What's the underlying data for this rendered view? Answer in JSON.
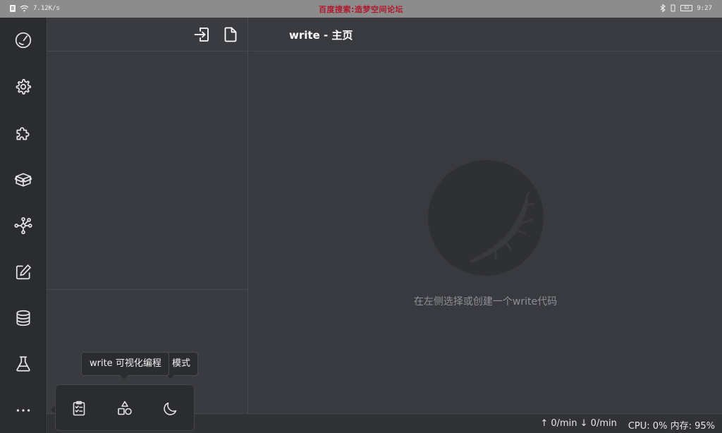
{
  "status_bar": {
    "net_speed": "7.12K/s",
    "banner": "百度搜索:造梦空间论坛",
    "battery": "82",
    "time": "9:27"
  },
  "rail": {
    "items": [
      {
        "id": "dashboard",
        "icon": "gauge-icon"
      },
      {
        "id": "settings",
        "icon": "gear-icon"
      },
      {
        "id": "plugins",
        "icon": "puzzle-icon"
      },
      {
        "id": "packages",
        "icon": "box-icon"
      },
      {
        "id": "network",
        "icon": "network-icon"
      },
      {
        "id": "editor",
        "icon": "edit-icon"
      },
      {
        "id": "database",
        "icon": "database-icon"
      },
      {
        "id": "lab",
        "icon": "flask-icon"
      }
    ],
    "more_label": "···"
  },
  "main": {
    "title": "write - 主页",
    "empty_hint": "在左侧选择或创建一个write代码"
  },
  "popup": {
    "tooltip_front": "write 可视化编程",
    "tooltip_back": "模式"
  },
  "bottom_bar": {
    "upload": "↑ 0/min",
    "download": "↓ 0/min",
    "cpu": "CPU: 0%",
    "memory": "内存: 95%"
  },
  "colors": {
    "background": "#393a3f",
    "rail": "#2b2c30",
    "status_bar": "#8c8c8c",
    "banner": "#b0182c"
  }
}
